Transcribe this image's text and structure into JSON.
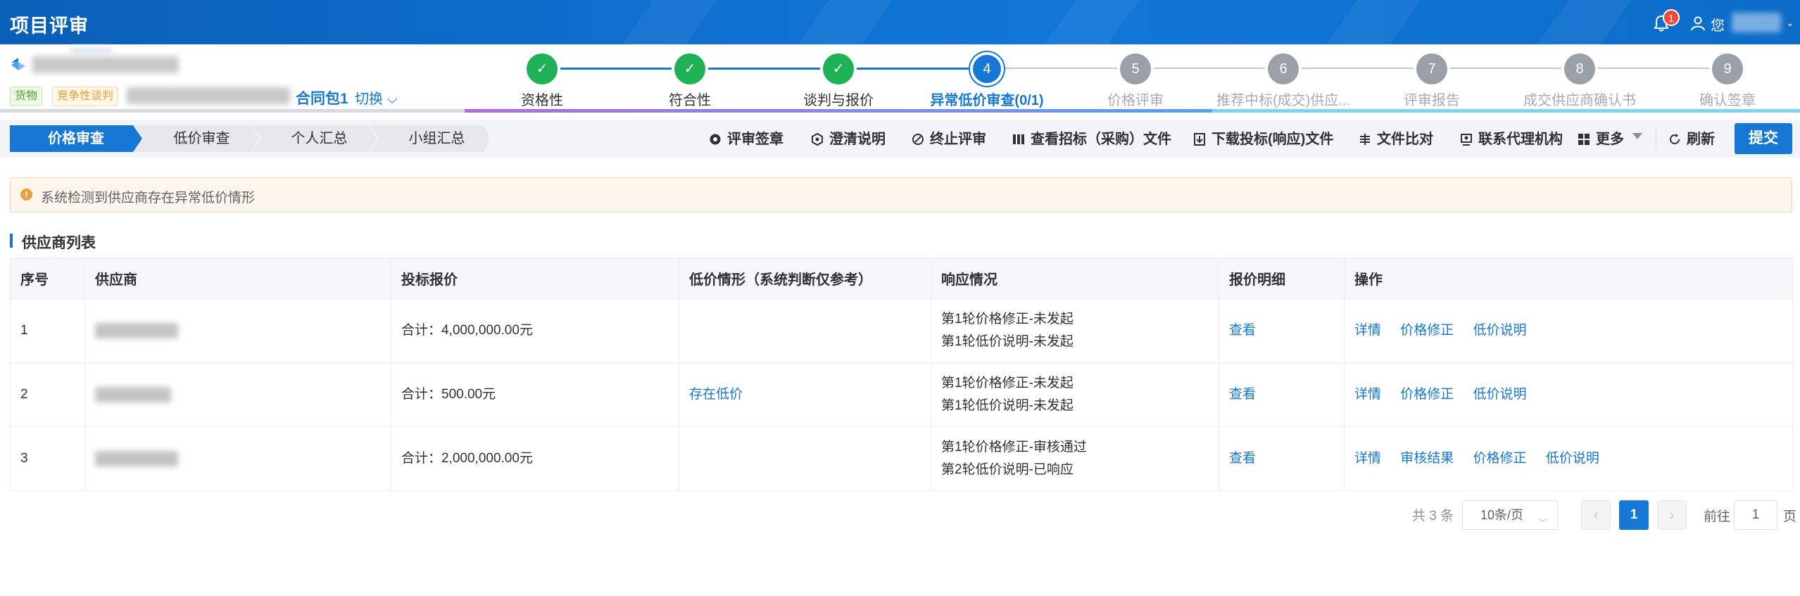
{
  "header": {
    "title": "项目评审",
    "notification_count": "1",
    "user_name_visible": "您"
  },
  "project": {
    "tags": [
      "货物",
      "竞争性谈判"
    ],
    "contract_label": "合同包1",
    "switch_label": "切换"
  },
  "steps": [
    {
      "index": "1",
      "label": "资格性",
      "state": "done"
    },
    {
      "index": "2",
      "label": "符合性",
      "state": "done"
    },
    {
      "index": "3",
      "label": "谈判与报价",
      "state": "done"
    },
    {
      "index": "4",
      "label": "异常低价审查(0/1)",
      "state": "current"
    },
    {
      "index": "5",
      "label": "价格评审",
      "state": "todo"
    },
    {
      "index": "6",
      "label": "推荐中标(成交)供应...",
      "state": "todo"
    },
    {
      "index": "7",
      "label": "评审报告",
      "state": "todo"
    },
    {
      "index": "8",
      "label": "成交供应商确认书",
      "state": "todo"
    },
    {
      "index": "9",
      "label": "确认签章",
      "state": "todo"
    }
  ],
  "subtabs": [
    {
      "label": "价格审查",
      "active": true
    },
    {
      "label": "低价审查",
      "active": false
    },
    {
      "label": "个人汇总",
      "active": false
    },
    {
      "label": "小组汇总",
      "active": false
    }
  ],
  "toolbar": {
    "sign": "评审签章",
    "clarify": "澄清说明",
    "terminate": "终止评审",
    "view_tender": "查看招标（采购）文件",
    "download_bid": "下载投标(响应)文件",
    "compare": "文件比对",
    "contact": "联系代理机构",
    "more": "更多",
    "refresh": "刷新",
    "submit": "提交"
  },
  "alert": {
    "text": "系统检测到供应商存在异常低价情形"
  },
  "section_title": "供应商列表",
  "table": {
    "headers": [
      "序号",
      "供应商",
      "投标报价",
      "低价情形（系统判断仅参考）",
      "响应情况",
      "报价明细",
      "操作"
    ],
    "rows": [
      {
        "no": "1",
        "price": "合计：4,000,000.00元",
        "low_price": "",
        "response_1": "第1轮价格修正-未发起",
        "response_2": "第1轮低价说明-未发起",
        "detail": "查看",
        "ops": [
          "详情",
          "价格修正",
          "低价说明"
        ]
      },
      {
        "no": "2",
        "price": "合计：500.00元",
        "low_price": "存在低价",
        "response_1": "第1轮价格修正-未发起",
        "response_2": "第1轮低价说明-未发起",
        "detail": "查看",
        "ops": [
          "详情",
          "价格修正",
          "低价说明"
        ]
      },
      {
        "no": "3",
        "price": "合计：2,000,000.00元",
        "low_price": "",
        "response_1": "第1轮价格修正-审核通过",
        "response_2": "第2轮低价说明-已响应",
        "detail": "查看",
        "ops": [
          "详情",
          "审核结果",
          "价格修正",
          "低价说明"
        ]
      }
    ]
  },
  "pagination": {
    "total": "共 3 条",
    "page_size": "10条/页",
    "current_page": "1",
    "goto_label": "前往",
    "goto_value": "1",
    "page_suffix": "页"
  },
  "colors": {
    "primary": "#1677d4",
    "success": "#1fb155",
    "warning": "#e6a23c",
    "danger": "#f5483b"
  }
}
